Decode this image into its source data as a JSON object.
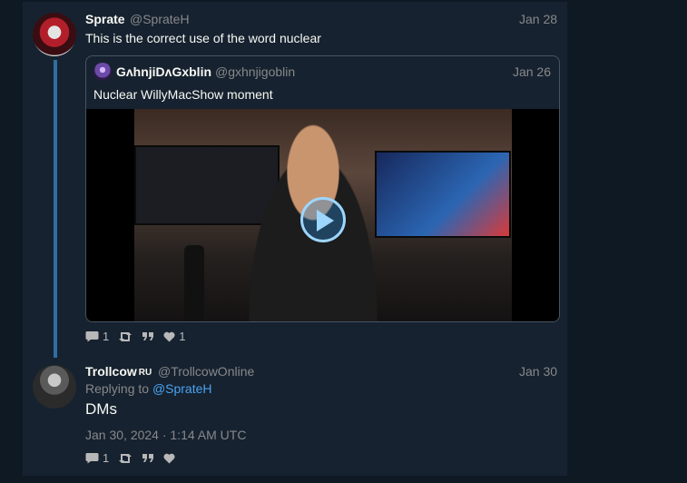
{
  "tweet1": {
    "name": "Sprate",
    "handle": "@SprateH",
    "date": "Jan 28",
    "text": "This is the correct use of the word nuclear",
    "stats": {
      "replies": "1",
      "likes": "1"
    }
  },
  "quote": {
    "name": "GʌhnjiDʌGxblin",
    "handle": "@gxhnjigoblin",
    "date": "Jan 26",
    "text": "Nuclear WillyMacShow moment"
  },
  "tweet2": {
    "name": "Trollcow",
    "badge": "RU",
    "handle": "@TrollcowOnline",
    "date": "Jan 30",
    "replying_prefix": "Replying to",
    "replying_to": "@SprateH",
    "text": "DMs",
    "full_date": "Jan 30, 2024 · 1:14 AM UTC",
    "stats": {
      "replies": "1"
    }
  },
  "icons": {
    "reply": "comment-icon",
    "retweet": "retweet-icon",
    "quote": "quote-icon",
    "like": "heart-icon",
    "play": "play-icon"
  },
  "colors": {
    "background": "#0f1923",
    "panel": "#162230",
    "thread_line": "#2e6fa3",
    "link": "#4aa3f0",
    "muted": "#888889"
  }
}
